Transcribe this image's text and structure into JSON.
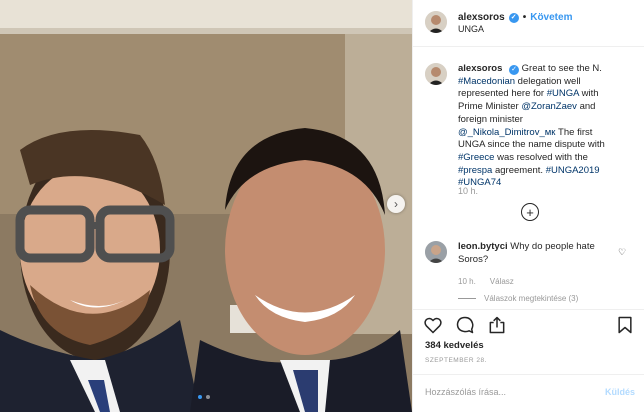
{
  "post": {
    "username": "alexsoros",
    "follow_label": "Követem",
    "location": "UNGA",
    "caption": {
      "username": "alexsoros",
      "segments": [
        {
          "t": "Great to see the N. "
        },
        {
          "t": "#Macedonian",
          "tag": true
        },
        {
          "t": " delegation well represented here for "
        },
        {
          "t": "#UNGA",
          "tag": true
        },
        {
          "t": " with Prime Minister "
        },
        {
          "t": "@ZoranZaev",
          "tag": true
        },
        {
          "t": " and foreign minister "
        },
        {
          "t": "@_Nikola_Dimitrov_мк",
          "tag": true
        },
        {
          "t": " The first UNGA since the name dispute with "
        },
        {
          "t": "#Greece",
          "tag": true
        },
        {
          "t": " was resolved with the "
        },
        {
          "t": "#prespa",
          "tag": true
        },
        {
          "t": " agreement. "
        },
        {
          "t": "#UNGA2019",
          "tag": true
        },
        {
          "t": " "
        },
        {
          "t": "#UNGA74",
          "tag": true
        }
      ],
      "time": "10 h."
    },
    "comment": {
      "username": "leon.bytyci",
      "text": "Why do people hate Soros?",
      "time": "10 h.",
      "reply_label": "Válasz",
      "view_replies": "Válaszok megtekintése (3)"
    },
    "likes": "384 kedvelés",
    "date": "SZEPTEMBER 28.",
    "comment_placeholder": "Hozzászólás írása...",
    "post_label": "Küldés",
    "carousel": {
      "slides": 2,
      "active": 0
    },
    "colors": {
      "link": "#3897f0",
      "hashtag": "#003569",
      "muted": "#999999"
    },
    "icons": {
      "verified": "verified-badge-icon",
      "next": "chevron-right-icon",
      "load_more": "plus-circle-icon",
      "like": "heart-icon",
      "comment": "comment-icon",
      "share": "share-icon",
      "save": "bookmark-icon"
    }
  }
}
